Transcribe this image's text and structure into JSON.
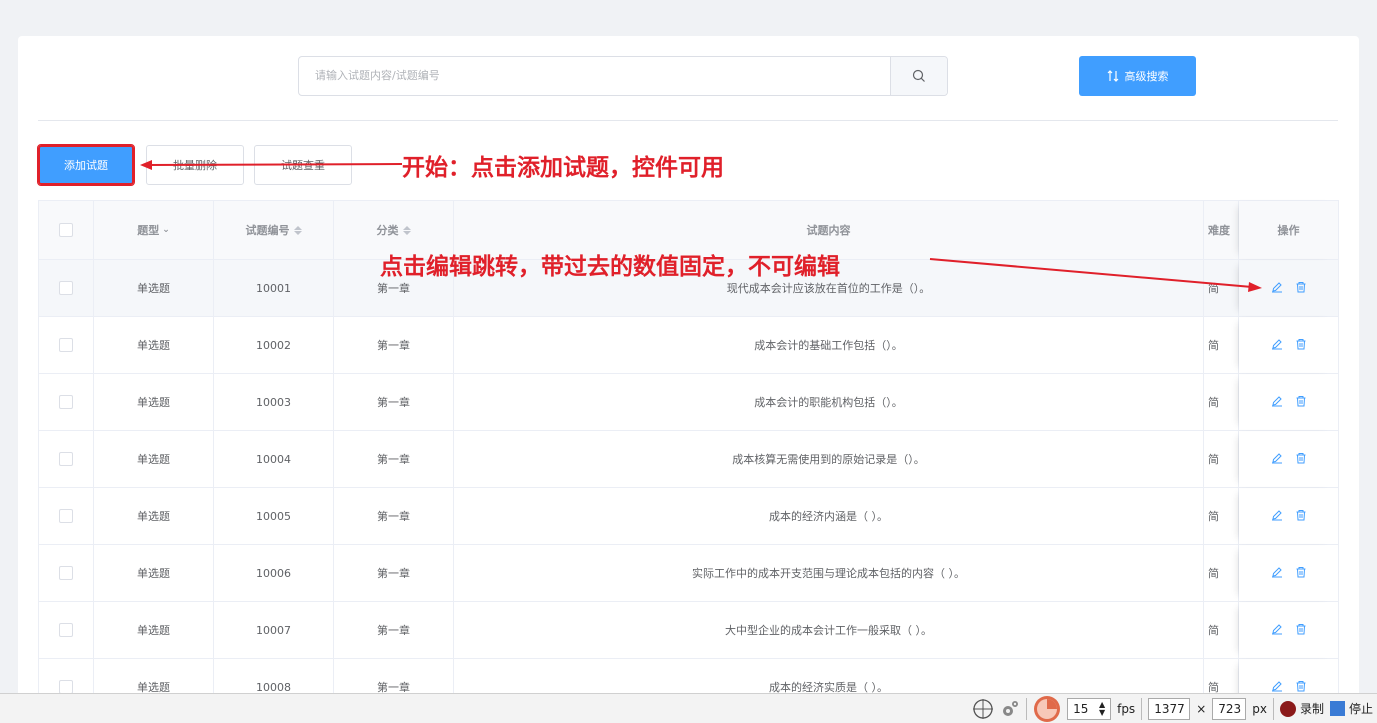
{
  "search": {
    "placeholder": "请输入试题内容/试题编号",
    "advanced_label": "高级搜索"
  },
  "toolbar": {
    "add_label": "添加试题",
    "batch_delete_label": "批量删除",
    "check_label": "试题查重"
  },
  "table": {
    "headers": {
      "type": "题型",
      "number": "试题编号",
      "category": "分类",
      "content": "试题内容",
      "difficulty": "难度",
      "action": "操作"
    },
    "rows": [
      {
        "type": "单选题",
        "number": "10001",
        "category": "第一章",
        "content": "现代成本会计应该放在首位的工作是（）。",
        "difficulty": "简"
      },
      {
        "type": "单选题",
        "number": "10002",
        "category": "第一章",
        "content": "成本会计的基础工作包括（）。",
        "difficulty": "简"
      },
      {
        "type": "单选题",
        "number": "10003",
        "category": "第一章",
        "content": "成本会计的职能机构包括（）。",
        "difficulty": "简"
      },
      {
        "type": "单选题",
        "number": "10004",
        "category": "第一章",
        "content": "成本核算无需使用到的原始记录是（）。",
        "difficulty": "简"
      },
      {
        "type": "单选题",
        "number": "10005",
        "category": "第一章",
        "content": "成本的经济内涵是（ ）。",
        "difficulty": "简"
      },
      {
        "type": "单选题",
        "number": "10006",
        "category": "第一章",
        "content": "实际工作中的成本开支范围与理论成本包括的内容（ ）。",
        "difficulty": "简"
      },
      {
        "type": "单选题",
        "number": "10007",
        "category": "第一章",
        "content": "大中型企业的成本会计工作一般采取（ ）。",
        "difficulty": "简"
      },
      {
        "type": "单选题",
        "number": "10008",
        "category": "第一章",
        "content": "成本的经济实质是（ ）。",
        "difficulty": "简"
      }
    ]
  },
  "annotations": {
    "start": "开始：点击添加试题，控件可用",
    "edit": "点击编辑跳转，带过去的数值固定，不可编辑"
  },
  "statusbar": {
    "fps_value": "15",
    "fps_unit": "fps",
    "width": "1377",
    "times": "×",
    "height": "723",
    "px": "px",
    "record": "录制",
    "stop": "停止"
  },
  "colors": {
    "primary": "#409eff",
    "annotation": "#e0202a"
  }
}
